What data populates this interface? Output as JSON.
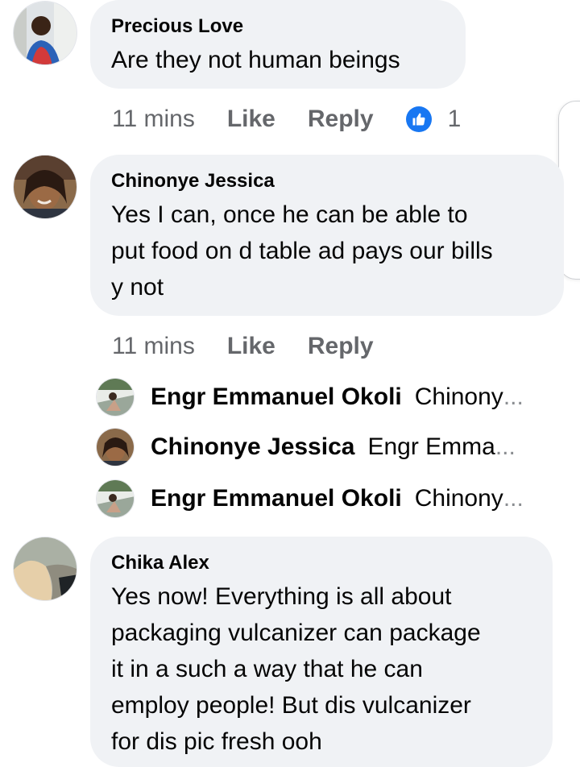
{
  "comments": [
    {
      "author": "Precious Love",
      "text": "Are they not human  beings",
      "time": "11 mins",
      "like_label": "Like",
      "reply_label": "Reply",
      "reaction_count": "1"
    },
    {
      "author": "Chinonye Jessica",
      "text": "Yes I can, once he can be able to\nput food on d table ad pays our bills\ny not",
      "time": "11 mins",
      "like_label": "Like",
      "reply_label": "Reply",
      "replies": [
        {
          "author": "Engr Emmanuel Okoli",
          "preview": "Chinony",
          "ellipsis": "..."
        },
        {
          "author": "Chinonye Jessica",
          "preview": "Engr Emma",
          "ellipsis": "..."
        },
        {
          "author": "Engr Emmanuel Okoli",
          "preview": "Chinony",
          "ellipsis": "..."
        }
      ]
    },
    {
      "author": "Chika Alex",
      "text": "Yes now! Everything is all about\npackaging vulcanizer can package\nit in a such a way that he can\nemploy people! But dis vulcanizer\nfor dis pic fresh ooh"
    }
  ],
  "colors": {
    "bubble": "#f0f2f5",
    "meta_text": "#65676b",
    "like_badge": "#1877f2"
  },
  "icons": {
    "reaction": "thumbs-up-icon"
  }
}
